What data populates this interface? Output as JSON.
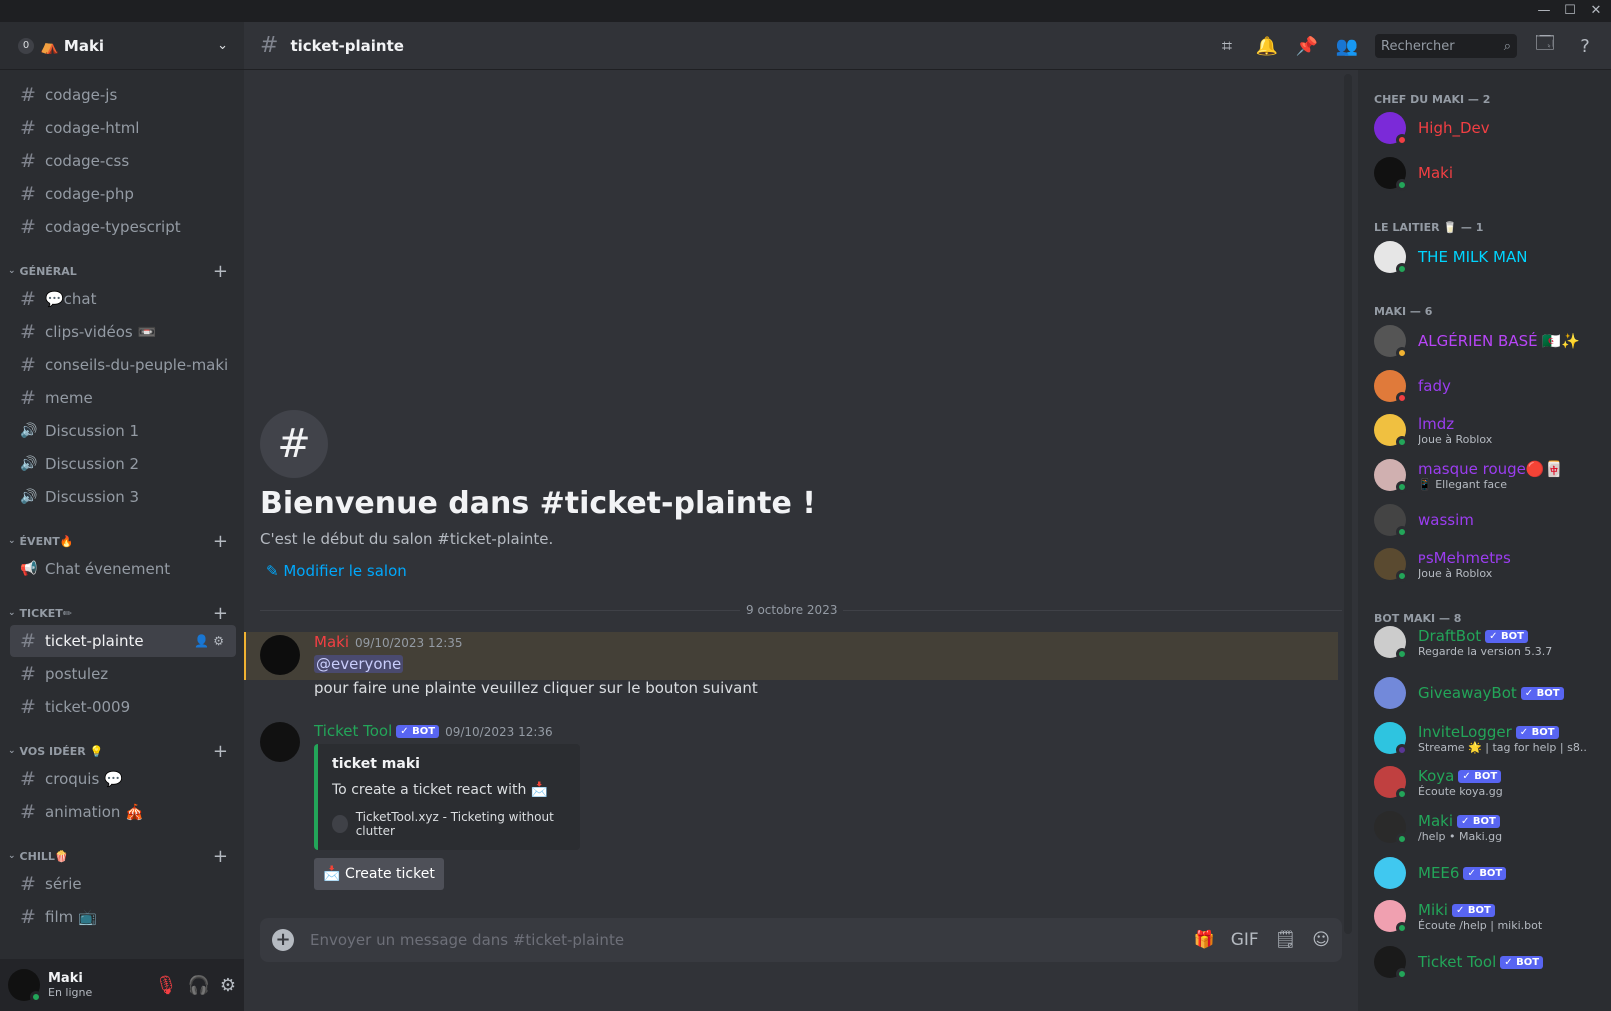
{
  "window": {
    "minimize": "—",
    "maximize": "☐",
    "close": "✕"
  },
  "server": {
    "badge": "0",
    "name": "⛺ Maki"
  },
  "categories": [
    {
      "label": "GÉNÉRAL"
    },
    {
      "label": "ÉVENT🔥"
    },
    {
      "label": "TICKET✏"
    },
    {
      "label": "VOS IDÉER 💡"
    },
    {
      "label": "CHILL🍿"
    }
  ],
  "channels": [
    {
      "label": "codage-js",
      "icon": "#"
    },
    {
      "label": "codage-html",
      "icon": "#"
    },
    {
      "label": "codage-css",
      "icon": "#"
    },
    {
      "label": "codage-php",
      "icon": "#"
    },
    {
      "label": "codage-typescript",
      "icon": "#"
    },
    {
      "label": "💬chat",
      "icon": "#"
    },
    {
      "label": "clips-vidéos 📼",
      "icon": "#"
    },
    {
      "label": "conseils-du-peuple-maki",
      "icon": "#"
    },
    {
      "label": "meme",
      "icon": "#"
    },
    {
      "label": "Discussion 1",
      "icon": "🔊"
    },
    {
      "label": "Discussion 2",
      "icon": "🔊"
    },
    {
      "label": "Discussion 3",
      "icon": "🔊"
    },
    {
      "label": "Chat évenement",
      "icon": "📢"
    },
    {
      "label": "ticket-plainte",
      "icon": "#"
    },
    {
      "label": "postulez",
      "icon": "#"
    },
    {
      "label": "ticket-0009",
      "icon": "#"
    },
    {
      "label": "croquis 💬",
      "icon": "#"
    },
    {
      "label": "animation 🎪",
      "icon": "#"
    },
    {
      "label": "série",
      "icon": "#"
    },
    {
      "label": "film 📺",
      "icon": "#"
    }
  ],
  "user": {
    "name": "Maki",
    "status": "En ligne"
  },
  "topbar": {
    "channel": "ticket-plainte",
    "search_placeholder": "Rechercher"
  },
  "welcome": {
    "title": "Bienvenue dans #ticket-plainte !",
    "subtitle": "C'est le début du salon #ticket-plainte.",
    "edit": "Modifier le salon"
  },
  "date_divider": "9 octobre 2023",
  "messages": [
    {
      "author": "Maki",
      "time": "09/10/2023 12:35",
      "mention": "@everyone",
      "text": "pour faire une plainte veuillez cliquer sur le bouton suivant",
      "color": "#f23f43"
    },
    {
      "author": "Ticket Tool",
      "badge": "✓ BOT",
      "time": "09/10/2023 12:36",
      "color": "#23a559",
      "embed": {
        "title": "ticket maki",
        "desc": "To create a ticket react with 📩",
        "footer": "TicketTool.xyz - Ticketing without clutter"
      },
      "button": "📩 Create ticket"
    }
  ],
  "composer": {
    "placeholder": "Envoyer un message dans #ticket-plainte"
  },
  "member_groups": [
    {
      "label": "CHEF DU MAKI — 2"
    },
    {
      "label": "LE LAITIER 🥛 — 1"
    },
    {
      "label": "MAKI — 6"
    },
    {
      "label": "BOT MAKI — 8"
    }
  ],
  "members": [
    {
      "name": "High_Dev",
      "color": "#f23f43",
      "activity": "",
      "avatar": "#7b2ad8",
      "status": "#f23f43"
    },
    {
      "name": "Maki",
      "color": "#f23f43",
      "activity": "",
      "avatar": "#111111",
      "status": "#23a559"
    },
    {
      "name": "THE MILK MAN",
      "color": "#00d5ff",
      "activity": "",
      "avatar": "#e6e6e6",
      "status": "#23a559"
    },
    {
      "name": "ALGÉRIEN BASÉ 🇩🇿✨",
      "color": "#b845f7",
      "activity": "",
      "avatar": "#555555",
      "status": "#f0b232"
    },
    {
      "name": "fady",
      "color": "#9b3df0",
      "activity": "",
      "avatar": "#e07a3a",
      "status": "#f23f43"
    },
    {
      "name": "lmdz",
      "color": "#9b3df0",
      "activity": "Joue à Roblox",
      "avatar": "#f0c040",
      "status": "#23a559"
    },
    {
      "name": "masque rouge🔴🀄",
      "color": "#9b3df0",
      "activity": "📱 Ellegant face",
      "avatar": "#d0b0b0",
      "status": "#23a559"
    },
    {
      "name": "wassim",
      "color": "#9b3df0",
      "activity": "",
      "avatar": "#444444",
      "status": "#23a559"
    },
    {
      "name": "ᴘsMehmetᴘs",
      "color": "#9b3df0",
      "activity": "Joue à Roblox",
      "avatar": "#5a4a30",
      "status": "#23a559"
    },
    {
      "name": "DraftBot",
      "color": "#23a559",
      "activity": "Regarde la version 5.3.7",
      "avatar": "#cccccc",
      "status": "#23a559"
    },
    {
      "name": "GiveawayBot",
      "color": "#23a559",
      "activity": "",
      "avatar": "#7289da",
      "status": ""
    },
    {
      "name": "InviteLogger",
      "color": "#23a559",
      "activity": "Streame 🌟 | tag for help | s8...",
      "avatar": "#2ec4e0",
      "status": "#593695"
    },
    {
      "name": "Koya",
      "color": "#23a559",
      "activity": "Écoute koya.gg",
      "avatar": "#c04040",
      "status": "#23a559"
    },
    {
      "name": "Maki",
      "color": "#23a559",
      "activity": "/help • Maki.gg",
      "avatar": "#2a2a2a",
      "status": "#23a559"
    },
    {
      "name": "MEE6",
      "color": "#23a559",
      "activity": "",
      "avatar": "#40c8f0",
      "status": ""
    },
    {
      "name": "Miki",
      "color": "#23a559",
      "activity": "Écoute /help | miki.bot",
      "avatar": "#f0a0b0",
      "status": "#23a559"
    },
    {
      "name": "Ticket Tool",
      "color": "#23a559",
      "activity": "",
      "avatar": "#1a1a1a",
      "status": "#23a559"
    }
  ],
  "bot_badge": "✓ BOT"
}
